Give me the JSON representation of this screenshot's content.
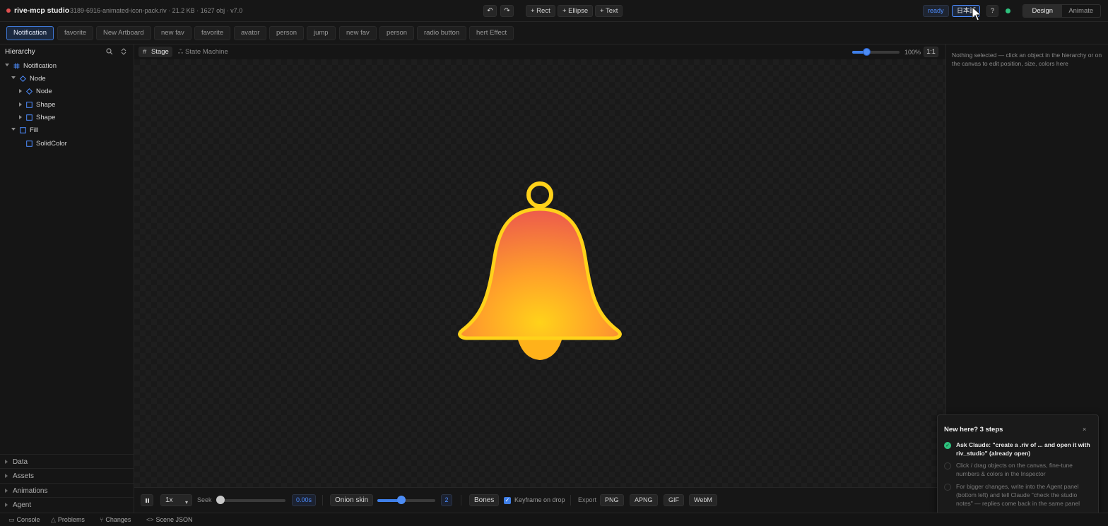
{
  "topbar": {
    "app_title": "rive-mcp studio",
    "file_info": "3189-6916-animated-icon-pack.riv · 21.2 KB · 1627 obj · v7.0",
    "undo_glyph": "↶",
    "redo_glyph": "↷",
    "tools": [
      "+ Rect",
      "+ Ellipse",
      "+ Text"
    ],
    "status": "ready",
    "language": "日本語",
    "help": "?",
    "modes": [
      "Design",
      "Animate"
    ],
    "active_mode": "Design"
  },
  "artboards": {
    "tabs": [
      "Notification",
      "favorite",
      "New Artboard",
      "new fav",
      "favorite",
      "avator",
      "person",
      "jump",
      "new fav",
      "person",
      "radio button",
      "hert Effect"
    ],
    "active": "Notification"
  },
  "hierarchy": {
    "title": "Hierarchy",
    "nodes": [
      {
        "label": "Notification",
        "icon": "artboard-icon"
      },
      {
        "label": "Node",
        "icon": "node-diamond-icon"
      },
      {
        "label": "Node",
        "icon": "node-diamond-icon"
      },
      {
        "label": "Shape",
        "icon": "shape-square-icon"
      },
      {
        "label": "Shape",
        "icon": "shape-square-icon"
      },
      {
        "label": "Fill",
        "icon": "fill-square-icon"
      },
      {
        "label": "SolidColor",
        "icon": "solidcolor-square-icon"
      }
    ],
    "sections": [
      "Data",
      "Assets",
      "Animations",
      "Agent"
    ]
  },
  "view": {
    "tabs": [
      "Stage",
      "State Machine"
    ],
    "active_tab": "Stage",
    "zoom": "100%",
    "zoom_level": 0.25,
    "fit_label": "1:1"
  },
  "playback": {
    "speed": "1x",
    "seek_label": "Seek",
    "seek_value": "0.00s",
    "seek_position": 0,
    "onion_label": "Onion skin",
    "onion_value": "2",
    "onion_level": 0.4,
    "bones_label": "Bones",
    "keyframe_label": "Keyframe on drop",
    "keyframe_checked": true,
    "export_label": "Export",
    "export_formats": [
      "PNG",
      "APNG",
      "GIF",
      "WebM"
    ]
  },
  "inspector": {
    "empty_text": "Nothing selected — click an object in the hierarchy or on the canvas to edit position, size, colors here"
  },
  "onboarding": {
    "title": "New here? 3 steps",
    "close": "×",
    "steps": [
      {
        "text": "Ask Claude: \"create a .riv of ... and open it with riv_studio\" (already open)",
        "done": true
      },
      {
        "text": "Click / drag objects on the canvas, fine-tune numbers & colors in the Inspector",
        "done": false
      },
      {
        "text": "For bigger changes, write into the Agent panel (bottom left) and tell Claude \"check the studio notes\" — replies come back in the same panel",
        "done": false
      }
    ]
  },
  "statusbar": {
    "items": [
      {
        "label": "Console",
        "icon": "console-icon"
      },
      {
        "label": "Problems",
        "icon": "warning-icon"
      },
      {
        "label": "Changes",
        "icon": "branch-icon"
      },
      {
        "label": "Scene JSON",
        "icon": "code-icon"
      }
    ]
  },
  "colors": {
    "accent": "#3f7fe8",
    "ready_dot": "#2ec27e",
    "bell_outline": "#ffd21a",
    "bell_top": "#ef6a48",
    "bell_bottom": "#ffb21a"
  }
}
